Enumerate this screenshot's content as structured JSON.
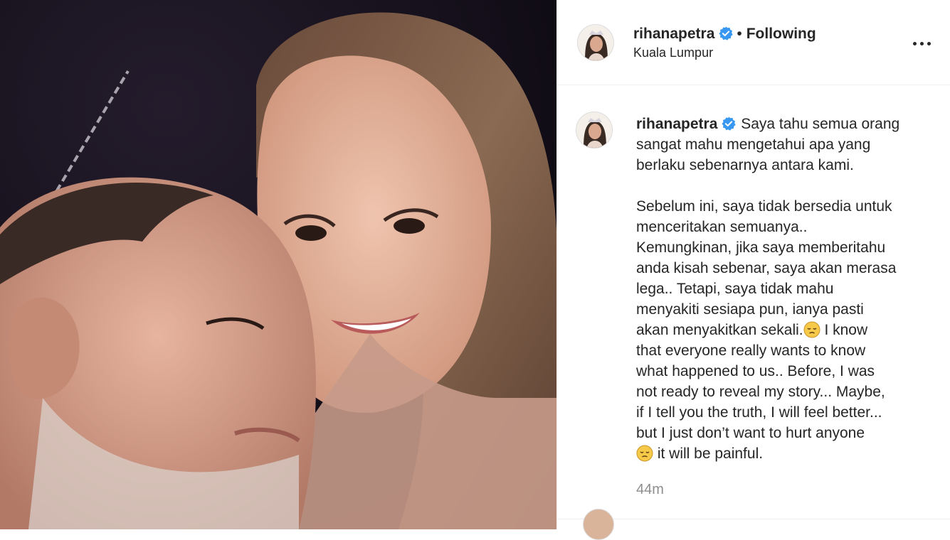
{
  "post": {
    "username": "rihanapetra",
    "separator": "•",
    "follow_status": "Following",
    "location": "Kuala Lumpur",
    "caption_part1": "Saya tahu semua orang\nsangat mahu mengetahui apa yang\nberlaku sebenarnya antara kami.\n\nSebelum ini, saya tidak bersedia untuk\nmenceritakan semuanya..\nKemungkinan, jika saya memberitahu\nanda kisah sebenar, saya akan merasa\nlega.. Tetapi, saya tidak mahu\nmenyakiti sesiapa pun, ianya pasti\nakan menyakitkan sekali.",
    "caption_part2": " I know\nthat everyone really wants to know\nwhat happened to us.. Before, I was\nnot ready to reveal my story... Maybe,\nif I tell you the truth, I will feel better...\nbut I just don’t want to hurt anyone\n",
    "caption_part3": " it will be painful.",
    "timestamp": "44m"
  },
  "icons": {
    "verified": "verified-badge-icon",
    "more": "more-options-icon",
    "emoji": "disappointed-face-emoji"
  },
  "colors": {
    "verified_blue": "#3897f0",
    "text": "#262626",
    "muted": "#8e8e8e",
    "emoji_yellow": "#f7c948"
  }
}
